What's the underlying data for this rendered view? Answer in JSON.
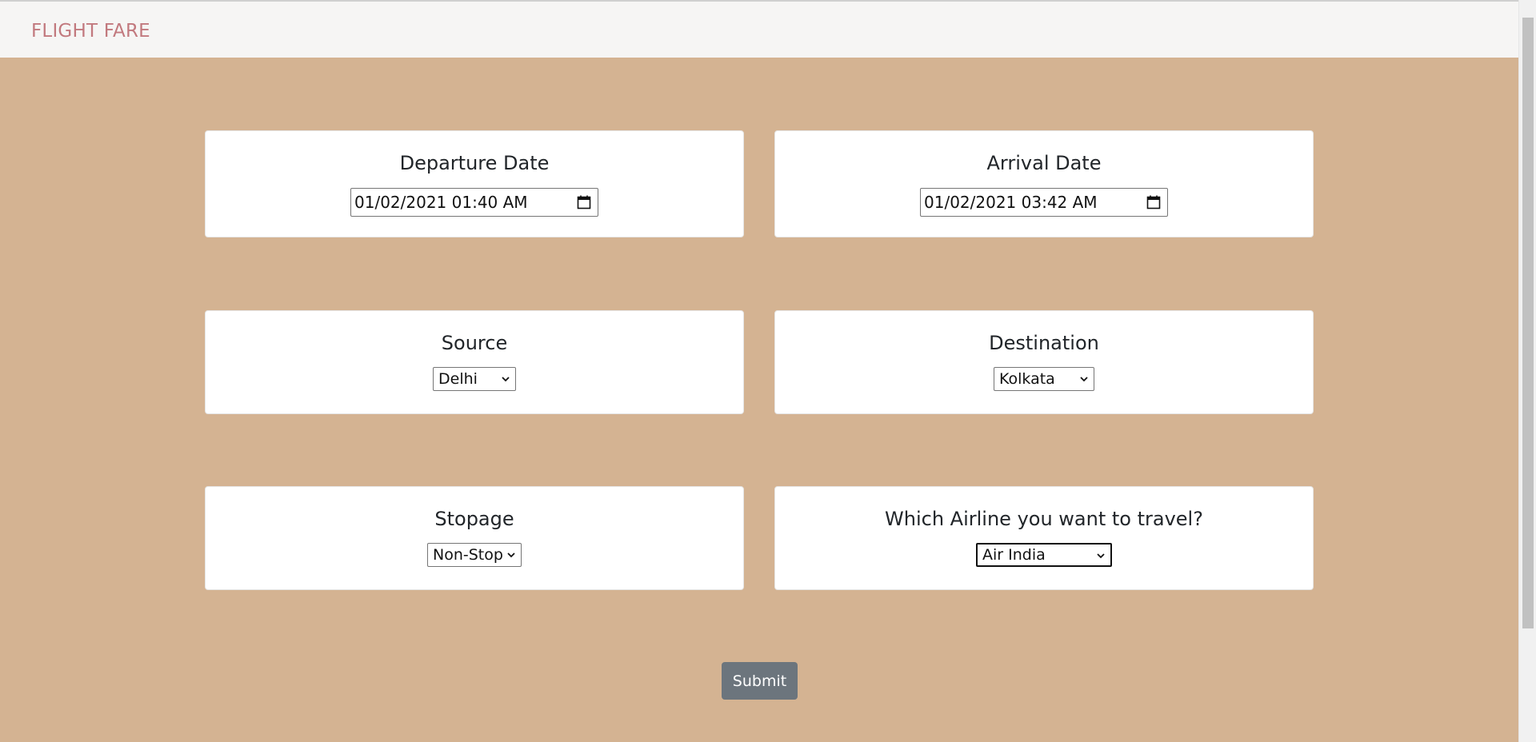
{
  "navbar": {
    "brand": "FLIGHT FARE"
  },
  "form": {
    "departure": {
      "label": "Departure Date",
      "value": "01/02/2021 01:40 AM",
      "icon": "calendar-icon"
    },
    "arrival": {
      "label": "Arrival Date",
      "value": "01/02/2021 03:42 AM",
      "icon": "calendar-icon"
    },
    "source": {
      "label": "Source",
      "value": "Delhi"
    },
    "destination": {
      "label": "Destination",
      "value": "Kolkata"
    },
    "stopage": {
      "label": "Stopage",
      "value": "Non-Stop"
    },
    "airline": {
      "label": "Which Airline you want to travel?",
      "value": "Air India"
    },
    "submit_label": "Submit"
  },
  "colors": {
    "page_background": "#d4b392",
    "navbar_background": "#f6f5f4",
    "brand": "#c2797e",
    "submit_button": "#6c757d"
  }
}
